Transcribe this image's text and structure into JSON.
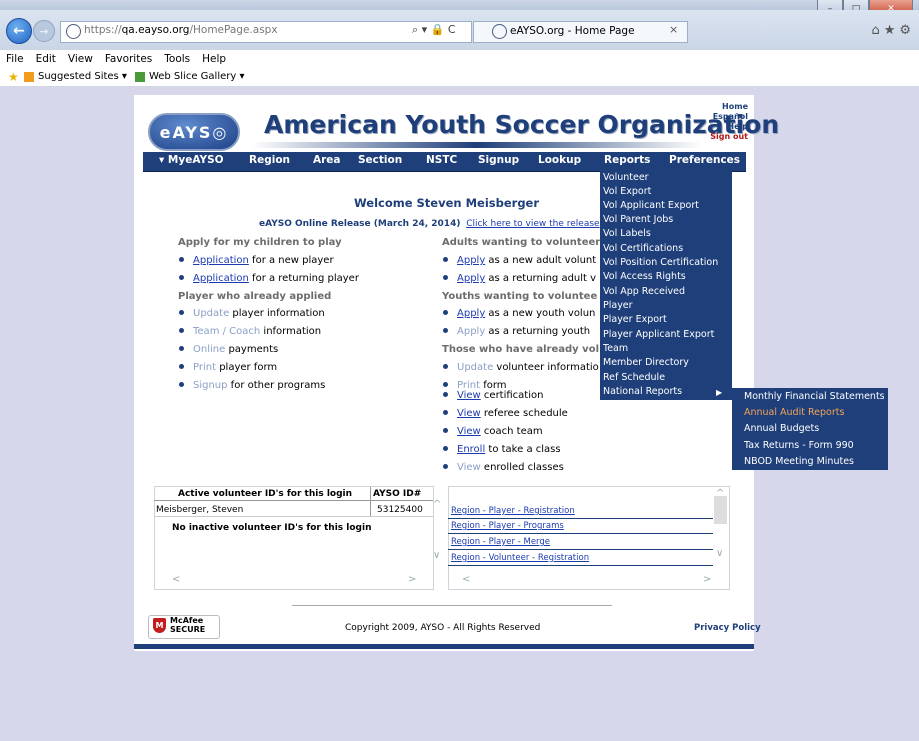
{
  "browser": {
    "url_prefix": "https://",
    "url_host": "qa.eayso.org",
    "url_path": "/HomePage.aspx",
    "address_icons": "⌕ ▾ 🔒 C",
    "tab_title": "eAYSO.org - Home Page",
    "tab_close": "×",
    "toolbar_icons": "⌂★⚙",
    "window_min": "–",
    "window_max": "□",
    "window_close": "✕",
    "menu": [
      "File",
      "Edit",
      "View",
      "Favorites",
      "Tools",
      "Help"
    ],
    "favorites": [
      "Suggested Sites ▾",
      "Web Slice Gallery ▾"
    ]
  },
  "site": {
    "logo": "eAYS◎",
    "org_name": "American Youth Soccer Organization",
    "top_links": [
      "Home",
      "Español",
      "Help",
      "Sign out"
    ],
    "nav": [
      "▾ MyeAYSO",
      "Region",
      "Area",
      "Section",
      "NSTC",
      "Signup",
      "Lookup",
      "Reports",
      "Preferences"
    ],
    "welcome": "Welcome Steven Meisberger",
    "release_prefix": "eAYSO Online Release (March 24, 2014)",
    "release_link": "Click here to view the release"
  },
  "left_col": [
    {
      "type": "section",
      "text": "Apply for my children to play"
    },
    {
      "type": "item",
      "link": "Application",
      "rest": " for a new player",
      "style": "link"
    },
    {
      "type": "item",
      "link": "Application",
      "rest": " for a returning player",
      "style": "link"
    },
    {
      "type": "section",
      "text": "Player who already applied"
    },
    {
      "type": "item",
      "link": "Update",
      "rest": " player information",
      "style": "dim"
    },
    {
      "type": "item",
      "link": "Team / Coach",
      "rest": " information",
      "style": "dim"
    },
    {
      "type": "item",
      "link": "Online",
      "rest": " payments",
      "style": "dim"
    },
    {
      "type": "item",
      "link": "Print",
      "rest": " player form",
      "style": "dim"
    },
    {
      "type": "item",
      "link": "Signup",
      "rest": " for other programs",
      "style": "dim"
    }
  ],
  "right_col": [
    {
      "type": "section",
      "text": "Adults wanting to volunteer"
    },
    {
      "type": "item",
      "link": "Apply",
      "rest": " as a new adult volunt",
      "style": "link"
    },
    {
      "type": "item",
      "link": "Apply",
      "rest": " as a returning adult v",
      "style": "link"
    },
    {
      "type": "section",
      "text": "Youths wanting to voluntee"
    },
    {
      "type": "item",
      "link": "Apply",
      "rest": " as a new youth volun",
      "style": "link"
    },
    {
      "type": "item",
      "link": "Apply",
      "rest": " as a returning youth",
      "style": "dim"
    },
    {
      "type": "section",
      "text": "Those who have already vol"
    },
    {
      "type": "item",
      "link": "Update",
      "rest": " volunteer informatio",
      "style": "dim"
    },
    {
      "type": "item",
      "link": "Print",
      "rest": " form",
      "style": "dim"
    },
    {
      "type": "item",
      "link": "View",
      "rest": " certification",
      "style": "link"
    },
    {
      "type": "item",
      "link": "View",
      "rest": " referee schedule",
      "style": "link"
    },
    {
      "type": "item",
      "link": "View",
      "rest": " coach team",
      "style": "link"
    },
    {
      "type": "item",
      "link": "Enroll",
      "rest": " to take a class",
      "style": "link"
    },
    {
      "type": "item",
      "link": "View",
      "rest": " enrolled classes",
      "style": "dim"
    }
  ],
  "reports_menu": [
    "Volunteer",
    "Vol Export",
    "Vol Applicant Export",
    "Vol Parent Jobs",
    "Vol Labels",
    "Vol Certifications",
    "Vol Position Certification",
    "Vol Access Rights",
    "Vol App Received",
    "Player",
    "Player Export",
    "Player Applicant Export",
    "Team",
    "Member Directory",
    "Ref Schedule",
    "National Reports"
  ],
  "submenu_arrow": "▶",
  "national_reports_menu": [
    "Monthly Financial Statements",
    "Annual Audit Reports",
    "Annual Budgets",
    "Tax Returns - Form 990",
    "NBOD Meeting Minutes"
  ],
  "highlight_color": "#f1a45a",
  "ids_table": {
    "header_label": "Active volunteer ID's for this login",
    "header_id": "AYSO ID#",
    "name": "Meisberger, Steven",
    "id": "53125400",
    "inactive": "No inactive volunteer ID's for this login"
  },
  "report_links": [
    "Region - Player - Registration",
    "Region - Player - Programs",
    "Region - Player - Merge",
    "Region - Volunteer - Registration"
  ],
  "scroll": {
    "left": "<",
    "right": ">",
    "up": "^",
    "down": "∨"
  },
  "footer": {
    "mcafee": "McAfee",
    "mcafee_secure": "SECURE",
    "copyright": "Copyright 2009, AYSO - All Rights Reserved",
    "privacy": "Privacy Policy"
  }
}
